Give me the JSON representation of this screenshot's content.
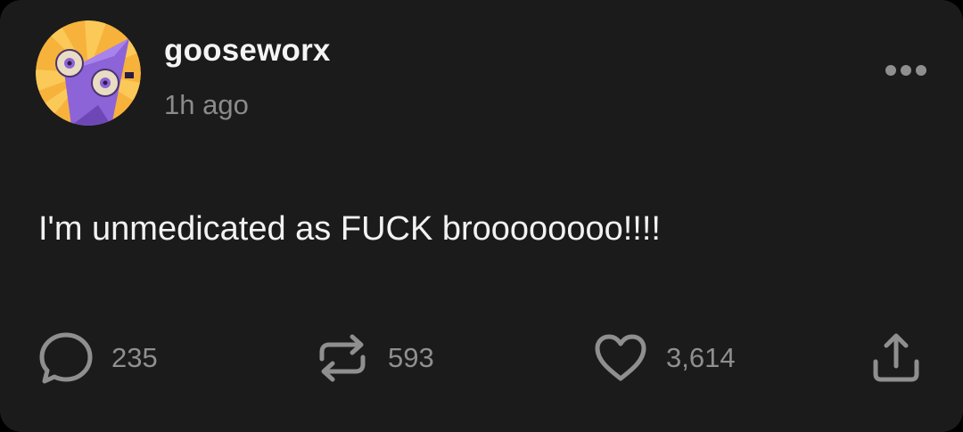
{
  "post": {
    "author": {
      "username": "gooseworx",
      "avatar_icon": "triangle-eyes-character-icon"
    },
    "timestamp": "1h ago",
    "text": "I'm unmedicated as FUCK broooooooo!!!!",
    "actions": {
      "more_icon": "more-dots-icon",
      "reply": {
        "icon": "speech-bubble-icon",
        "count": "235"
      },
      "reblog": {
        "icon": "repost-arrows-icon",
        "count": "593"
      },
      "like": {
        "icon": "heart-icon",
        "count": "3,614"
      },
      "share": {
        "icon": "share-upload-icon"
      }
    }
  },
  "colors": {
    "background": "#1b1b1b",
    "primary_text": "#f4f4f4",
    "secondary_text": "#8b8b8b",
    "icon": "#8f8f8f",
    "avatar_bg": "#f7b23b",
    "avatar_character": "#8d63d8"
  }
}
